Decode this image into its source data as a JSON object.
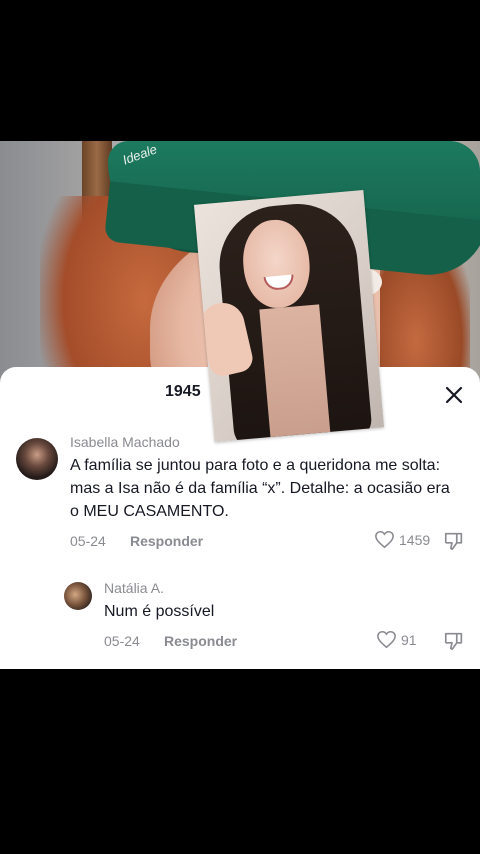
{
  "video": {
    "cap_text": "Ideale"
  },
  "sheet": {
    "comment_count": "1945"
  },
  "comments": [
    {
      "author": "Isabella Machado",
      "text": "A família se juntou para foto e a queridona me solta: mas a Isa não é da família “x”. Detalhe: a ocasião era o MEU CASAMENTO.",
      "date": "05-24",
      "reply_label": "Responder",
      "likes": "1459"
    },
    {
      "author": "Natália A.",
      "text": "Num é possível",
      "date": "05-24",
      "reply_label": "Responder",
      "likes": "91"
    }
  ],
  "icons": {
    "close": "close-icon",
    "like": "heart-outline-icon",
    "dislike": "thumbs-down-icon"
  }
}
